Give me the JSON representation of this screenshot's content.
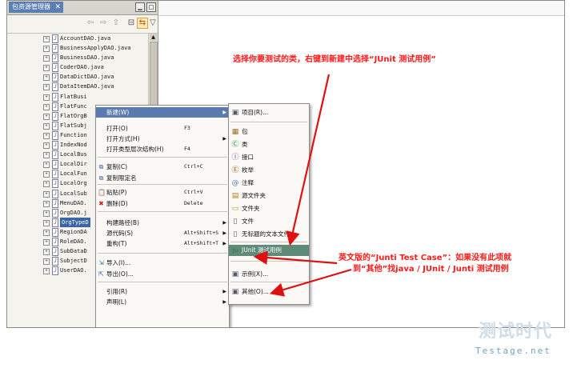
{
  "explorer": {
    "tab_label": "包资源管理器",
    "close_glyph": "✕",
    "files": [
      "AccountDAO.java",
      "BusinessApplyDAO.java",
      "BusinessDAO.java",
      "CoderDAO.java",
      "DataDictDAO.java",
      "DataItemDAO.java",
      "FlatBusi",
      "FlatFunc",
      "FlatOrgB",
      "FlatSubj",
      "Function",
      "IndexNod",
      "LocalBus",
      "LocalDir",
      "LocalFun",
      "LocalOrg",
      "LocalSub",
      "MenuDAO.",
      "OrgDAO.j",
      "OrgTypeD",
      "RegionDA",
      "RoleDAO.",
      "SubDataD",
      "SubjectD",
      "UserDAO."
    ],
    "selected_index": 19
  },
  "context_menu": {
    "items": [
      {
        "label": "新建(W)",
        "accel": "",
        "submenu": true,
        "icon": ""
      },
      {
        "label": "打开(O)",
        "accel": "F3",
        "submenu": false,
        "icon": ""
      },
      {
        "label": "打开方式(H)",
        "accel": "",
        "submenu": true,
        "icon": ""
      },
      {
        "label": "打开类型层次结构(H)",
        "accel": "F4",
        "submenu": false,
        "icon": ""
      },
      {
        "label": "复制(C)",
        "accel": "Ctrl+C",
        "submenu": false,
        "icon": "copy-icon"
      },
      {
        "label": "复制限定名",
        "accel": "",
        "submenu": false,
        "icon": "copy-qualified-icon"
      },
      {
        "label": "粘贴(P)",
        "accel": "Ctrl+V",
        "submenu": false,
        "icon": "paste-icon"
      },
      {
        "label": "删除(D)",
        "accel": "Delete",
        "submenu": false,
        "icon": "delete-icon"
      },
      {
        "label": "构建路径(B)",
        "accel": "",
        "submenu": true,
        "icon": ""
      },
      {
        "label": "源代码(S)",
        "accel": "Alt+Shift+S",
        "submenu": true,
        "icon": ""
      },
      {
        "label": "重构(T)",
        "accel": "Alt+Shift+T",
        "submenu": true,
        "icon": ""
      },
      {
        "label": "导入(I)...",
        "accel": "",
        "submenu": false,
        "icon": "import-icon"
      },
      {
        "label": "导出(O)...",
        "accel": "",
        "submenu": false,
        "icon": "export-icon"
      },
      {
        "label": "引用(R)",
        "accel": "",
        "submenu": true,
        "icon": ""
      },
      {
        "label": "声明(L)",
        "accel": "",
        "submenu": true,
        "icon": ""
      }
    ]
  },
  "submenu": {
    "items": [
      {
        "label": "项目(R)...",
        "icon": "project-icon"
      },
      {
        "label": "包",
        "icon": "package-icon"
      },
      {
        "label": "类",
        "icon": "class-icon"
      },
      {
        "label": "接口",
        "icon": "interface-icon"
      },
      {
        "label": "枚举",
        "icon": "enum-icon"
      },
      {
        "label": "注释",
        "icon": "annotation-icon"
      },
      {
        "label": "源文件夹",
        "icon": "source-folder-icon"
      },
      {
        "label": "文件夹",
        "icon": "folder-icon"
      },
      {
        "label": "文件",
        "icon": "file-icon"
      },
      {
        "label": "无标题的文本文件",
        "icon": "untitled-text-file-icon"
      },
      {
        "label": "JUnit 测试用例",
        "icon": "junit-icon"
      },
      {
        "label": "示例(X)...",
        "icon": "example-icon"
      },
      {
        "label": "其他(O)...",
        "icon": "other-icon"
      }
    ],
    "highlighted_index": 10
  },
  "annotations": {
    "top_note": "选择你要测试的类，右键到新建中选择“JUnit 测试用例”",
    "bottom_note_line1": "英文版的“Junti Test Case”：如果没有此项就",
    "bottom_note_line2": "到“其他”找java / JUnit / Junti 测试用例"
  },
  "watermark": {
    "main": "测试时代",
    "sub": "Testage.net"
  },
  "colors": {
    "accent": "#5a7ab0",
    "annotation": "#ff1a1a",
    "watermark": "#6fa3c2"
  }
}
